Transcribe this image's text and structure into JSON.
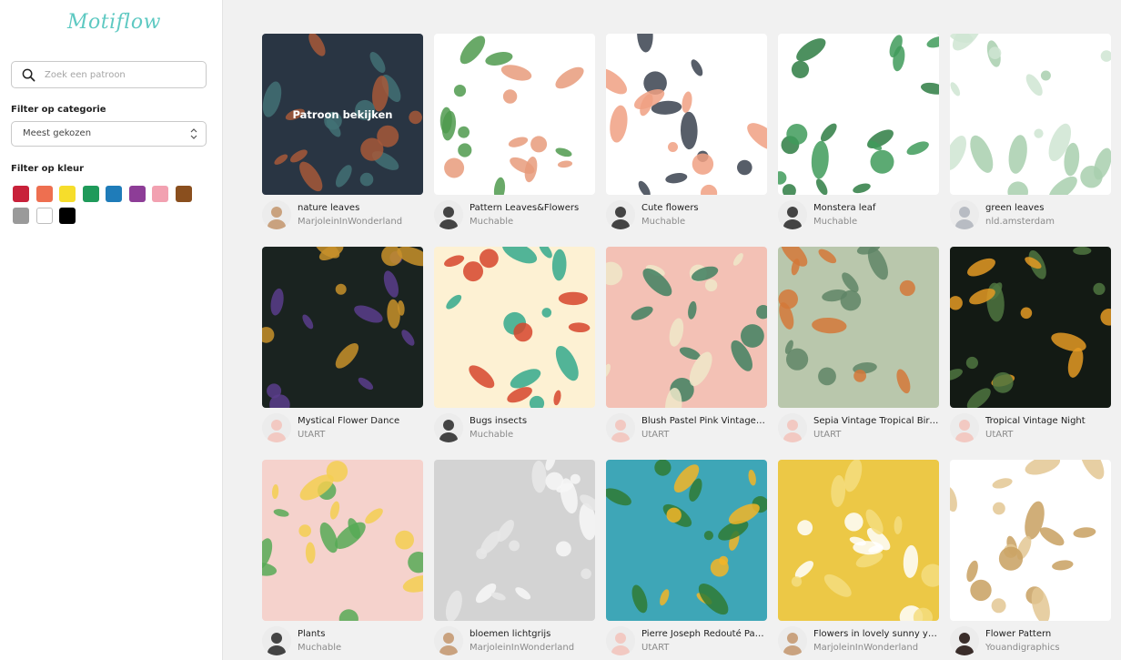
{
  "brand": {
    "logo_text": "Motiflow",
    "accent": "#5ec9c2"
  },
  "sidebar": {
    "search": {
      "placeholder": "Zoek een patroon",
      "value": ""
    },
    "category_filter": {
      "label": "Filter op categorie",
      "selected": "Meest gekozen"
    },
    "color_filter": {
      "label": "Filter op kleur",
      "colors": [
        {
          "name": "red",
          "hex": "#c8213a"
        },
        {
          "name": "orange",
          "hex": "#ee6f50"
        },
        {
          "name": "yellow",
          "hex": "#f6dd2b"
        },
        {
          "name": "green",
          "hex": "#1f9a5a"
        },
        {
          "name": "blue",
          "hex": "#1f7cb9"
        },
        {
          "name": "purple",
          "hex": "#8d3d97"
        },
        {
          "name": "pink",
          "hex": "#f2a1b1"
        },
        {
          "name": "brown",
          "hex": "#8a4f1e"
        },
        {
          "name": "grey",
          "hex": "#9a9a9a"
        },
        {
          "name": "white",
          "hex": "#ffffff"
        },
        {
          "name": "black",
          "hex": "#000000"
        }
      ]
    }
  },
  "hover_overlay_label": "Patroon bekijken",
  "patterns": [
    {
      "title": "nature leaves",
      "author": "MarjoleinInWonderland",
      "bg": "#2c3a48",
      "motif": "#d46a3c",
      "motif2": "#4e8a8c",
      "avatar": "#c9a27f"
    },
    {
      "title": "Pattern Leaves&Flowers",
      "author": "Muchable",
      "bg": "#ffffff",
      "motif": "#4f9a4e",
      "motif2": "#e89b7b",
      "avatar": "#444444"
    },
    {
      "title": "Cute flowers",
      "author": "Muchable",
      "bg": "#ffffff",
      "motif": "#f0a083",
      "motif2": "#39424f",
      "avatar": "#444444"
    },
    {
      "title": "Monstera leaf",
      "author": "Muchable",
      "bg": "#ffffff",
      "motif": "#3f9b5a",
      "motif2": "#2e7d43",
      "avatar": "#444444"
    },
    {
      "title": "green leaves",
      "author": "nld.amsterdam",
      "bg": "#ffffff",
      "motif": "#a8cfae",
      "motif2": "#cfe5d2",
      "avatar": "#b8bcc3"
    },
    {
      "title": "Mystical Flower Dance",
      "author": "UtART",
      "bg": "#1a2320",
      "motif": "#5a3d8c",
      "motif2": "#c8902a",
      "avatar": "#f2c9c2"
    },
    {
      "title": "Bugs insects",
      "author": "Muchable",
      "bg": "#fdf1d3",
      "motif": "#d6452c",
      "motif2": "#34a98c",
      "avatar": "#444444"
    },
    {
      "title": "Blush Pastel Pink Vintage …",
      "author": "UtART",
      "bg": "#f3c1b5",
      "motif": "#efe7c9",
      "motif2": "#3f8060",
      "avatar": "#f2c9c2"
    },
    {
      "title": "Sepia Vintage Tropical Bird…",
      "author": "UtART",
      "bg": "#b9c7ac",
      "motif": "#d47838",
      "motif2": "#5f8566",
      "avatar": "#f2c9c2"
    },
    {
      "title": "Tropical Vintage Night",
      "author": "UtART",
      "bg": "#131a14",
      "motif": "#e49a23",
      "motif2": "#4f7540",
      "avatar": "#f2c9c2"
    },
    {
      "title": "Plants",
      "author": "Muchable",
      "bg": "#f5d2cc",
      "motif": "#f3cf50",
      "motif2": "#57aa56",
      "avatar": "#444444"
    },
    {
      "title": "bloemen lichtgrijs",
      "author": "MarjoleinInWonderland",
      "bg": "#d3d3d3",
      "motif": "#e8e8e8",
      "motif2": "#f7f7f7",
      "avatar": "#c9a27f"
    },
    {
      "title": "Pierre Joseph Redouté Par…",
      "author": "UtART",
      "bg": "#3ea6b7",
      "motif": "#f3b527",
      "motif2": "#2f7a34",
      "avatar": "#f2c9c2"
    },
    {
      "title": "Flowers in lovely sunny yel…",
      "author": "MarjoleinInWonderland",
      "bg": "#ecc846",
      "motif": "#f4dd7f",
      "motif2": "#ffffff",
      "avatar": "#c9a27f"
    },
    {
      "title": "Flower Pattern",
      "author": "Youandigraphics",
      "bg": "#ffffff",
      "motif": "#c8a060",
      "motif2": "#e3c793",
      "avatar": "#3a2d2a"
    }
  ]
}
